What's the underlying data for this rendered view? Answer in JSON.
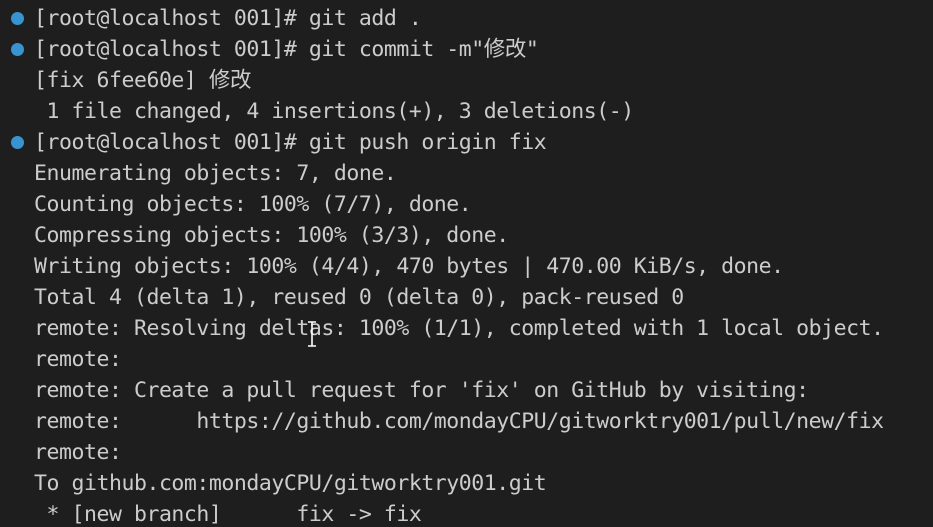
{
  "prompt_prefix": "[root@localhost 001]# ",
  "terminal": {
    "lines": [
      {
        "text": "git add .",
        "is_command": true
      },
      {
        "text": "git commit -m\"修改\"",
        "is_command": true
      },
      {
        "text": "[fix 6fee60e] 修改",
        "is_command": false
      },
      {
        "text": " 1 file changed, 4 insertions(+), 3 deletions(-)",
        "is_command": false
      },
      {
        "text": "git push origin fix",
        "is_command": true
      },
      {
        "text": "Enumerating objects: 7, done.",
        "is_command": false
      },
      {
        "text": "Counting objects: 100% (7/7), done.",
        "is_command": false
      },
      {
        "text": "Compressing objects: 100% (3/3), done.",
        "is_command": false
      },
      {
        "text": "Writing objects: 100% (4/4), 470 bytes | 470.00 KiB/s, done.",
        "is_command": false
      },
      {
        "text": "Total 4 (delta 1), reused 0 (delta 0), pack-reused 0",
        "is_command": false
      },
      {
        "text": "remote: Resolving deltas: 100% (1/1), completed with 1 local object.",
        "is_command": false
      },
      {
        "text": "remote:",
        "is_command": false
      },
      {
        "text": "remote: Create a pull request for 'fix' on GitHub by visiting:",
        "is_command": false
      },
      {
        "text": "remote:      https://github.com/mondayCPU/gitworktry001/pull/new/fix",
        "is_command": false
      },
      {
        "text": "remote:",
        "is_command": false
      },
      {
        "text": "To github.com:mondayCPU/gitworktry001.git",
        "is_command": false
      },
      {
        "text": " * [new branch]      fix -> fix",
        "is_command": false
      }
    ]
  },
  "colors": {
    "background": "#1e1e1e",
    "text": "#cccccc",
    "command_decoration": "#3794d1"
  },
  "icons": {
    "command_decoration": "circle-dot-icon",
    "mouse_cursor": "text-cursor-icon"
  }
}
